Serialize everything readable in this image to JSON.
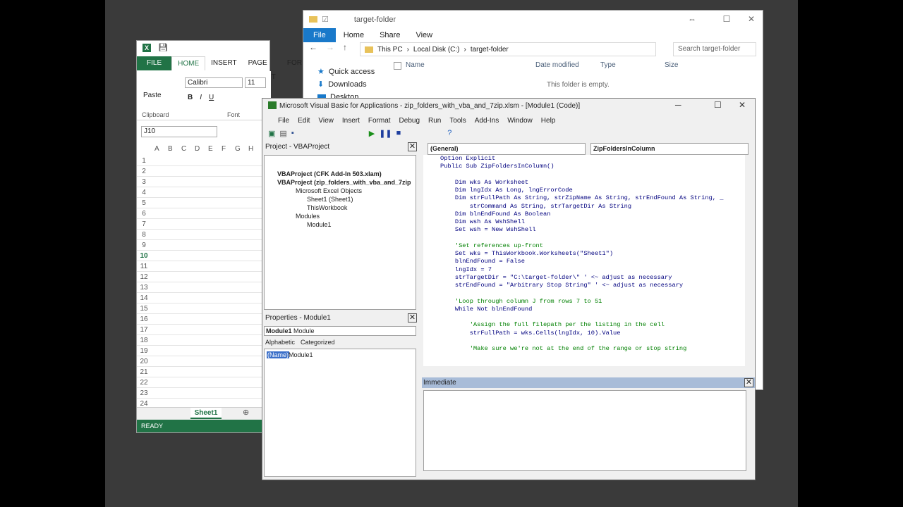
{
  "explorer": {
    "title": "target-folder",
    "tabs": [
      "File",
      "Home",
      "Share",
      "View"
    ],
    "address": [
      "This PC",
      "Local Disk (C:)",
      "target-folder"
    ],
    "search_placeholder": "Search target-folder",
    "nav": [
      "Quick access",
      "Downloads",
      "Desktop"
    ],
    "columns": [
      "Name",
      "Date modified",
      "Type",
      "Size"
    ],
    "empty_text": "This folder is empty."
  },
  "excel": {
    "tabs": [
      "FILE",
      "HOME",
      "INSERT",
      "PAGE LAYOUT",
      "FOR"
    ],
    "font": "Calibri",
    "font_size": "11",
    "paste": "Paste",
    "clipboard": "Clipboard",
    "font_group": "Font",
    "name_box": "J10",
    "columns": [
      "A",
      "B",
      "C",
      "D",
      "E",
      "F",
      "G",
      "H"
    ],
    "rows": [
      "1",
      "2",
      "3",
      "4",
      "5",
      "6",
      "7",
      "8",
      "9",
      "10",
      "11",
      "12",
      "13",
      "14",
      "15",
      "16",
      "17",
      "18",
      "19",
      "20",
      "21",
      "22",
      "23",
      "24"
    ],
    "sheet": "Sheet1",
    "status": "READY"
  },
  "vba": {
    "title": "Microsoft Visual Basic for Applications - zip_folders_with_vba_and_7zip.xlsm - [Module1 (Code)]",
    "menu": [
      "File",
      "Edit",
      "View",
      "Insert",
      "Format",
      "Debug",
      "Run",
      "Tools",
      "Add-Ins",
      "Window",
      "Help"
    ],
    "project_title": "Project - VBAProject",
    "tree": [
      "VBAProject (CFK Add-In 503.xlam)",
      "VBAProject (zip_folders_with_vba_and_7zip",
      "Microsoft Excel Objects",
      "Sheet1 (Sheet1)",
      "ThisWorkbook",
      "Modules",
      "Module1"
    ],
    "properties_title": "Properties - Module1",
    "prop_object": "Module1",
    "prop_type": "Module",
    "prop_tabs": [
      "Alphabetic",
      "Categorized"
    ],
    "prop_name": "(Name)",
    "prop_value": "Module1",
    "combo_left": "(General)",
    "combo_right": "ZipFoldersInColumn",
    "immediate_title": "Immediate",
    "code": [
      {
        "t": "Option Explicit",
        "c": "kw"
      },
      {
        "t": "Public Sub ZipFoldersInColumn()",
        "c": "kw"
      },
      {
        "t": "",
        "c": "tx"
      },
      {
        "t": "    Dim wks As Worksheet",
        "c": "kw"
      },
      {
        "t": "    Dim lngIdx As Long, lngErrorCode",
        "c": "kw"
      },
      {
        "t": "    Dim strFullPath As String, strZipName As String, strEndFound As String, _",
        "c": "kw"
      },
      {
        "t": "        strCommand As String, strTargetDir As String",
        "c": "kw"
      },
      {
        "t": "    Dim blnEndFound As Boolean",
        "c": "kw"
      },
      {
        "t": "    Dim wsh As WshShell",
        "c": "kw"
      },
      {
        "t": "    Set wsh = New WshShell",
        "c": "kw"
      },
      {
        "t": "",
        "c": "tx"
      },
      {
        "t": "    'Set references up-front",
        "c": "cm"
      },
      {
        "t": "    Set wks = ThisWorkbook.Worksheets(\"Sheet1\")",
        "c": "kw"
      },
      {
        "t": "    blnEndFound = False",
        "c": "kw"
      },
      {
        "t": "    lngIdx = 7",
        "c": "kw"
      },
      {
        "t": "    strTargetDir = \"C:\\target-folder\\\" ' <~ adjust as necessary",
        "c": "kw"
      },
      {
        "t": "    strEndFound = \"Arbitrary Stop String\" ' <~ adjust as necessary",
        "c": "kw"
      },
      {
        "t": "",
        "c": "tx"
      },
      {
        "t": "    'Loop through column J from rows 7 to 51",
        "c": "cm"
      },
      {
        "t": "    While Not blnEndFound",
        "c": "kw"
      },
      {
        "t": "",
        "c": "tx"
      },
      {
        "t": "        'Assign the full filepath per the listing in the cell",
        "c": "cm"
      },
      {
        "t": "        strFullPath = wks.Cells(lngIdx, 10).Value",
        "c": "kw"
      },
      {
        "t": "",
        "c": "tx"
      },
      {
        "t": "        'Make sure we're not at the end of the range or stop string",
        "c": "cm"
      }
    ]
  }
}
